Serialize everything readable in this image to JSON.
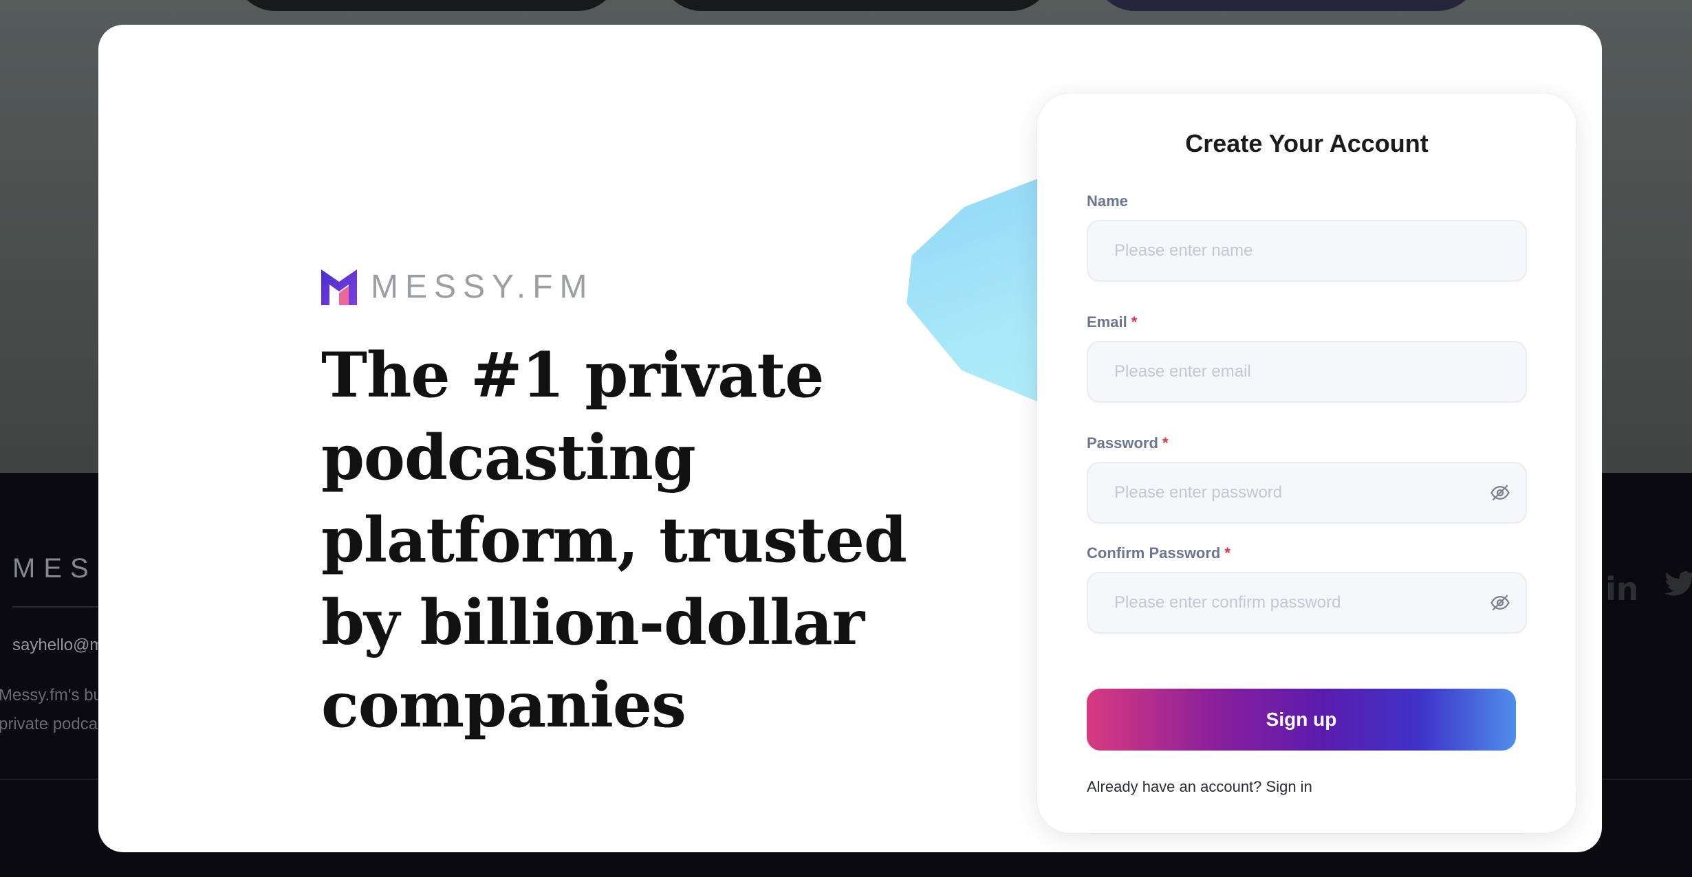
{
  "background": {
    "footer_logo": "MESSY.FM",
    "footer_email": "sayhello@messy.fm",
    "footer_desc_line1": "Messy.fm's business",
    "footer_desc_line2": "private podcasts in",
    "social_linkedin": "in"
  },
  "modal": {
    "close_label": "×",
    "brand": {
      "name": "MESSY.FM"
    },
    "headline": "The #1 private podcasting platform, trusted by billion-dollar companies"
  },
  "form": {
    "title": "Create Your Account",
    "name": {
      "label": "Name",
      "placeholder": "Please enter name",
      "required": false
    },
    "email": {
      "label": "Email",
      "placeholder": "Please enter email",
      "required": true
    },
    "password": {
      "label": "Password",
      "placeholder": "Please enter password",
      "required": true
    },
    "confirm_password": {
      "label": "Confirm Password",
      "placeholder": "Please enter confirm password",
      "required": true
    },
    "required_marker": "*",
    "submit_label": "Sign up",
    "signin_prompt": "Already have an account?",
    "signin_link": "Sign in"
  },
  "colors": {
    "brand_purple": "#5b1cae",
    "button_gradient_start": "#d83a80",
    "button_gradient_end": "#4f8eea",
    "required": "#e0324b",
    "label": "#6e7591"
  },
  "icons": {
    "close": "close-icon",
    "logo": "messy-logo-icon",
    "password_toggle": "eye-off-icon"
  }
}
